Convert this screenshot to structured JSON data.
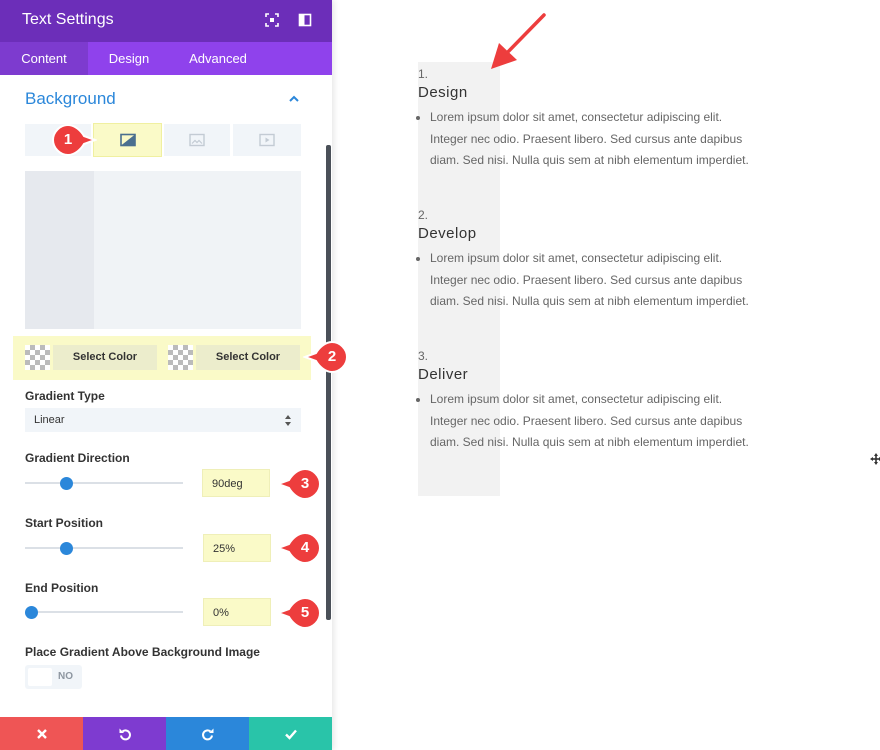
{
  "panel": {
    "title": "Text Settings",
    "tabs": [
      {
        "label": "Content",
        "active": true
      },
      {
        "label": "Design",
        "active": false
      },
      {
        "label": "Advanced",
        "active": false
      }
    ],
    "section_title": "Background",
    "background_tabs": [
      "gradient-icon",
      "image-icon",
      "video-icon"
    ],
    "color_buttons": [
      "Select Color",
      "Select Color"
    ],
    "gradient_type": {
      "label": "Gradient Type",
      "value": "Linear"
    },
    "gradient_direction": {
      "label": "Gradient Direction",
      "value": "90deg",
      "level": 0.25
    },
    "start_position": {
      "label": "Start Position",
      "value": "25%",
      "level": 0.25
    },
    "end_position": {
      "label": "End Position",
      "value": "0%",
      "level": 0
    },
    "place_gradient": {
      "label": "Place Gradient Above Background Image",
      "toggle": "NO"
    }
  },
  "markers": [
    "1",
    "2",
    "3",
    "4",
    "5"
  ],
  "colors": {
    "header": "#6c2eb9",
    "tabs": "#8f42ec",
    "accent": "#2b87da",
    "highlight": "#fafac8",
    "marker": "#ed3d3d",
    "cancel": "#ef5555",
    "undo": "#7e3bd0",
    "redo": "#2b87da",
    "save": "#29c4a9"
  },
  "preview": {
    "items": [
      {
        "number": "1.",
        "title": "Design",
        "text": "Lorem ipsum dolor sit amet, consectetur adipiscing elit. Integer nec odio. Praesent libero. Sed cursus ante dapibus diam. Sed nisi. Nulla quis sem at nibh elementum imperdiet."
      },
      {
        "number": "2.",
        "title": "Develop",
        "text": "Lorem ipsum dolor sit amet, consectetur adipiscing elit. Integer nec odio. Praesent libero. Sed cursus ante dapibus diam. Sed nisi. Nulla quis sem at nibh elementum imperdiet."
      },
      {
        "number": "3.",
        "title": "Deliver",
        "text": "Lorem ipsum dolor sit amet, consectetur adipiscing elit. Integer nec odio. Praesent libero. Sed cursus ante dapibus diam. Sed nisi. Nulla quis sem at nibh elementum imperdiet."
      }
    ]
  }
}
